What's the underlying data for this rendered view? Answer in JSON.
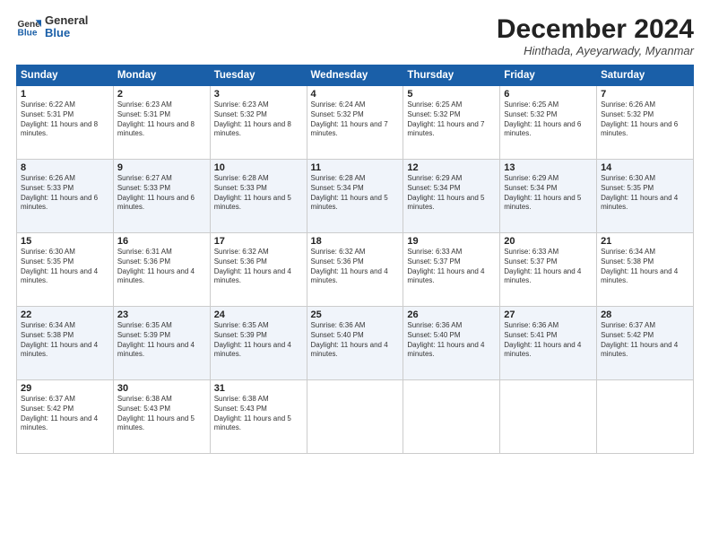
{
  "logo": {
    "general": "General",
    "blue": "Blue"
  },
  "header": {
    "month": "December 2024",
    "location": "Hinthada, Ayeyarwady, Myanmar"
  },
  "weekdays": [
    "Sunday",
    "Monday",
    "Tuesday",
    "Wednesday",
    "Thursday",
    "Friday",
    "Saturday"
  ],
  "weeks": [
    [
      {
        "day": "1",
        "rise": "6:22 AM",
        "set": "5:31 PM",
        "hours": "11 hours and 8 minutes."
      },
      {
        "day": "2",
        "rise": "6:23 AM",
        "set": "5:31 PM",
        "hours": "11 hours and 8 minutes."
      },
      {
        "day": "3",
        "rise": "6:23 AM",
        "set": "5:32 PM",
        "hours": "11 hours and 8 minutes."
      },
      {
        "day": "4",
        "rise": "6:24 AM",
        "set": "5:32 PM",
        "hours": "11 hours and 7 minutes."
      },
      {
        "day": "5",
        "rise": "6:25 AM",
        "set": "5:32 PM",
        "hours": "11 hours and 7 minutes."
      },
      {
        "day": "6",
        "rise": "6:25 AM",
        "set": "5:32 PM",
        "hours": "11 hours and 6 minutes."
      },
      {
        "day": "7",
        "rise": "6:26 AM",
        "set": "5:32 PM",
        "hours": "11 hours and 6 minutes."
      }
    ],
    [
      {
        "day": "8",
        "rise": "6:26 AM",
        "set": "5:33 PM",
        "hours": "11 hours and 6 minutes."
      },
      {
        "day": "9",
        "rise": "6:27 AM",
        "set": "5:33 PM",
        "hours": "11 hours and 6 minutes."
      },
      {
        "day": "10",
        "rise": "6:28 AM",
        "set": "5:33 PM",
        "hours": "11 hours and 5 minutes."
      },
      {
        "day": "11",
        "rise": "6:28 AM",
        "set": "5:34 PM",
        "hours": "11 hours and 5 minutes."
      },
      {
        "day": "12",
        "rise": "6:29 AM",
        "set": "5:34 PM",
        "hours": "11 hours and 5 minutes."
      },
      {
        "day": "13",
        "rise": "6:29 AM",
        "set": "5:34 PM",
        "hours": "11 hours and 5 minutes."
      },
      {
        "day": "14",
        "rise": "6:30 AM",
        "set": "5:35 PM",
        "hours": "11 hours and 4 minutes."
      }
    ],
    [
      {
        "day": "15",
        "rise": "6:30 AM",
        "set": "5:35 PM",
        "hours": "11 hours and 4 minutes."
      },
      {
        "day": "16",
        "rise": "6:31 AM",
        "set": "5:36 PM",
        "hours": "11 hours and 4 minutes."
      },
      {
        "day": "17",
        "rise": "6:32 AM",
        "set": "5:36 PM",
        "hours": "11 hours and 4 minutes."
      },
      {
        "day": "18",
        "rise": "6:32 AM",
        "set": "5:36 PM",
        "hours": "11 hours and 4 minutes."
      },
      {
        "day": "19",
        "rise": "6:33 AM",
        "set": "5:37 PM",
        "hours": "11 hours and 4 minutes."
      },
      {
        "day": "20",
        "rise": "6:33 AM",
        "set": "5:37 PM",
        "hours": "11 hours and 4 minutes."
      },
      {
        "day": "21",
        "rise": "6:34 AM",
        "set": "5:38 PM",
        "hours": "11 hours and 4 minutes."
      }
    ],
    [
      {
        "day": "22",
        "rise": "6:34 AM",
        "set": "5:38 PM",
        "hours": "11 hours and 4 minutes."
      },
      {
        "day": "23",
        "rise": "6:35 AM",
        "set": "5:39 PM",
        "hours": "11 hours and 4 minutes."
      },
      {
        "day": "24",
        "rise": "6:35 AM",
        "set": "5:39 PM",
        "hours": "11 hours and 4 minutes."
      },
      {
        "day": "25",
        "rise": "6:36 AM",
        "set": "5:40 PM",
        "hours": "11 hours and 4 minutes."
      },
      {
        "day": "26",
        "rise": "6:36 AM",
        "set": "5:40 PM",
        "hours": "11 hours and 4 minutes."
      },
      {
        "day": "27",
        "rise": "6:36 AM",
        "set": "5:41 PM",
        "hours": "11 hours and 4 minutes."
      },
      {
        "day": "28",
        "rise": "6:37 AM",
        "set": "5:42 PM",
        "hours": "11 hours and 4 minutes."
      }
    ],
    [
      {
        "day": "29",
        "rise": "6:37 AM",
        "set": "5:42 PM",
        "hours": "11 hours and 4 minutes."
      },
      {
        "day": "30",
        "rise": "6:38 AM",
        "set": "5:43 PM",
        "hours": "11 hours and 5 minutes."
      },
      {
        "day": "31",
        "rise": "6:38 AM",
        "set": "5:43 PM",
        "hours": "11 hours and 5 minutes."
      },
      null,
      null,
      null,
      null
    ]
  ],
  "labels": {
    "sunrise": "Sunrise:",
    "sunset": "Sunset:",
    "daylight": "Daylight: "
  }
}
